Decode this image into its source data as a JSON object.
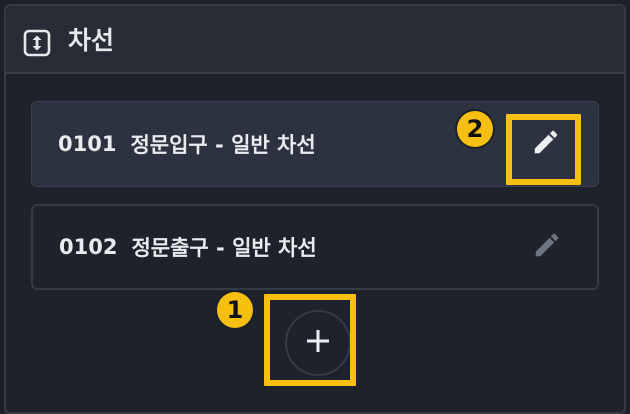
{
  "panel": {
    "title": "차선",
    "header_icon": "swap-vertical-icon"
  },
  "lanes": [
    {
      "code": "0101",
      "name": "정문입구 - 일반 차선",
      "state": "selected",
      "edit_icon": "pencil-icon"
    },
    {
      "code": "0102",
      "name": "정문출구 - 일반 차선",
      "state": "normal",
      "edit_icon": "pencil-icon"
    }
  ],
  "add_button": {
    "icon": "plus-icon"
  },
  "annotations": [
    {
      "number": "1",
      "target": "add-lane-button"
    },
    {
      "number": "2",
      "target": "edit-lane-button-0101"
    }
  ],
  "colors": {
    "highlight": "#f7bf0f",
    "panel_bg": "#1e222b",
    "header_bg": "#272c36",
    "selected_lane_bg": "#2c3240",
    "text": "#e9ebef"
  }
}
